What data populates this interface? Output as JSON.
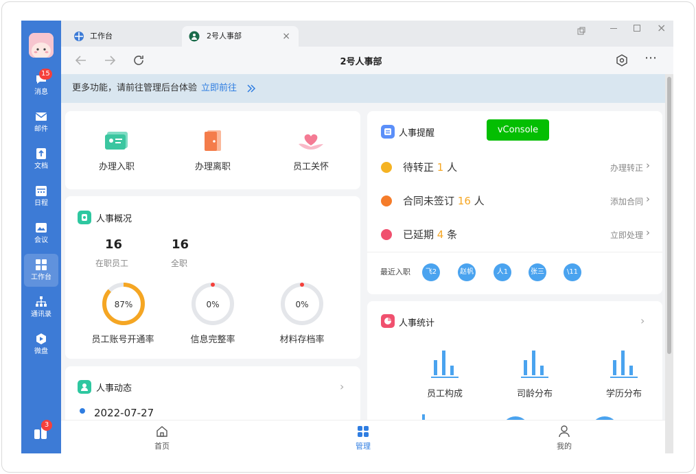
{
  "rail": {
    "items": [
      {
        "label": "消息",
        "icon": "chat-icon",
        "badge": "15"
      },
      {
        "label": "邮件",
        "icon": "mail-icon"
      },
      {
        "label": "文档",
        "icon": "document-icon"
      },
      {
        "label": "日程",
        "icon": "calendar-icon"
      },
      {
        "label": "会议",
        "icon": "meeting-icon"
      },
      {
        "label": "工作台",
        "icon": "grid-icon"
      },
      {
        "label": "通讯录",
        "icon": "org-chart-icon"
      },
      {
        "label": "微盘",
        "icon": "drive-icon"
      }
    ],
    "bottom_badge": "3"
  },
  "tabs": [
    {
      "label": "工作台",
      "icon": "workbench-icon"
    },
    {
      "label": "2号人事部",
      "icon": "hr-logo-icon"
    }
  ],
  "toolbar": {
    "title": "2号人事部"
  },
  "banner": {
    "text": "更多功能，请前往管理后台体验",
    "link": "立即前往"
  },
  "quick_actions": [
    {
      "label": "办理入职",
      "icon": "id-card-icon"
    },
    {
      "label": "办理离职",
      "icon": "exit-door-icon"
    },
    {
      "label": "员工关怀",
      "icon": "heart-hand-icon"
    }
  ],
  "overview": {
    "title": "人事概况",
    "stats": [
      {
        "value": "16",
        "label": "在职员工"
      },
      {
        "value": "16",
        "label": "全职"
      }
    ],
    "rings": [
      {
        "percent": 87,
        "text": "87%",
        "label": "员工账号开通率",
        "color": "#f5a623"
      },
      {
        "percent": 0,
        "text": "0%",
        "label": "信息完整率",
        "color": "#f5403b"
      },
      {
        "percent": 0,
        "text": "0%",
        "label": "材料存档率",
        "color": "#f5403b"
      }
    ]
  },
  "dynamics": {
    "title": "人事动态",
    "date": "2022-07-27"
  },
  "reminders": {
    "title": "人事提醒",
    "items": [
      {
        "prefix": "待转正",
        "count": "1",
        "unit": "人",
        "action": "办理转正",
        "color": "#f5b323"
      },
      {
        "prefix": "合同未签订",
        "count": "16",
        "unit": "人",
        "action": "添加合同",
        "color": "#f57c2a"
      },
      {
        "prefix": "已延期",
        "count": "4",
        "unit": "条",
        "action": "立即处理",
        "color": "#f0506e"
      }
    ],
    "recent_label": "最近入职",
    "recent": [
      "飞2",
      "赵帆",
      "人1",
      "张三",
      "\\11"
    ]
  },
  "stats": {
    "title": "人事统计",
    "items": [
      {
        "label": "员工构成"
      },
      {
        "label": "司龄分布"
      },
      {
        "label": "学历分布"
      }
    ]
  },
  "vconsole": "vConsole",
  "bottom_nav": [
    {
      "label": "首页",
      "icon": "home-icon"
    },
    {
      "label": "管理",
      "icon": "manage-grid-icon"
    },
    {
      "label": "我的",
      "icon": "person-icon"
    }
  ],
  "colors": {
    "rail": "#3d7bd6",
    "accent": "#2f7de1",
    "highlight": "#f5a623"
  }
}
